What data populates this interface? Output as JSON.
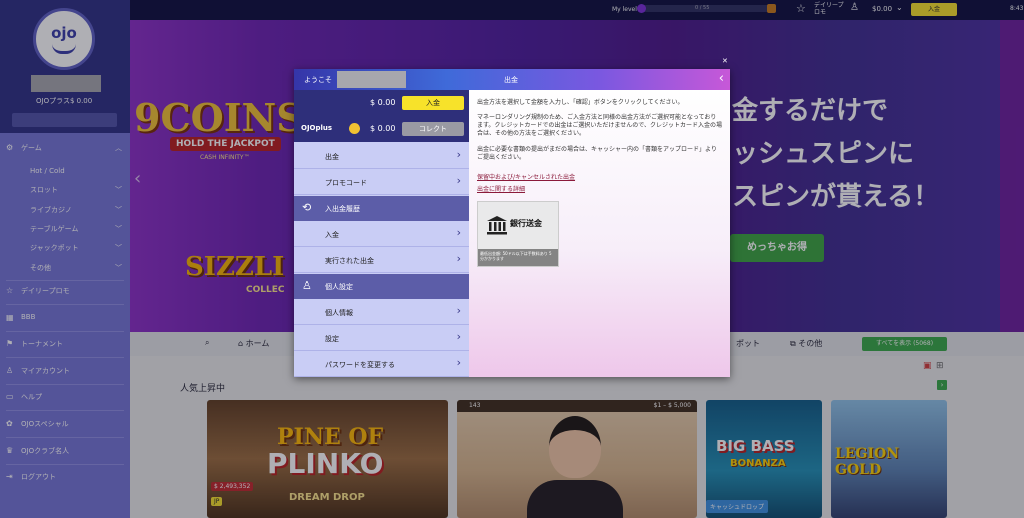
{
  "topbar": {
    "my_level": "My level",
    "level_progress": "0 / 55",
    "daily_promo": "デイリープロモ",
    "balance": "$0.00",
    "deposit": "入金",
    "time": "8:43"
  },
  "sidebar": {
    "logo": "ojo",
    "ojo_plus": "OJOプラス$ 0.00",
    "items": [
      {
        "label": "ゲーム"
      },
      {
        "label": "Hot / Cold"
      },
      {
        "label": "スロット"
      },
      {
        "label": "ライブカジノ"
      },
      {
        "label": "テーブルゲーム"
      },
      {
        "label": "ジャックポット"
      },
      {
        "label": "その他"
      },
      {
        "label": "デイリープロモ"
      },
      {
        "label": "BBB"
      },
      {
        "label": "トーナメント"
      },
      {
        "label": "マイアカウント"
      },
      {
        "label": "ヘルプ"
      },
      {
        "label": "OJOスペシャル"
      },
      {
        "label": "OJOクラブ名人"
      },
      {
        "label": "ログアウト"
      }
    ]
  },
  "banner": {
    "coin_title": "9COINS",
    "hold": "HOLD THE JACKPOT",
    "cash_infinity": "CASH INFINITY™",
    "sizzling": "SIZZLI",
    "collect": "COLLEC",
    "line1": "金するだけで",
    "line2": "ッシュスピンに",
    "line3": "スピンが貰える！",
    "cta": "めっちゃお得"
  },
  "tabs": {
    "home": "ホーム",
    "spot": "ポット",
    "other": "その他",
    "show_all": "すべてを表示 (5068)",
    "popular": "人気上昇中"
  },
  "tiles": {
    "plinko_top": "PINE OF",
    "plinko": "PLINKO",
    "dream_drop": "DREAM DROP",
    "plinko_jackpot": "$ 2,493,352",
    "live_count": "143",
    "live_range": "$1 – $ 5,000",
    "big_bass": "BIG BASS",
    "bonanza": "BONANZA",
    "cash_drop": "キャッシュドロップ",
    "legion": "LEGION GOLD"
  },
  "modal": {
    "welcome": "ようこそ",
    "title": "出金",
    "cash_balance": "$ 0.00",
    "deposit_btn": "入金",
    "ojoplus_label": "OJOplus",
    "ojoplus_balance": "$ 0.00",
    "collect_btn": "コレクト",
    "menu": [
      {
        "label": "出金",
        "type": "item"
      },
      {
        "label": "プロモコード",
        "type": "item"
      },
      {
        "label": "入出金履歴",
        "type": "section"
      },
      {
        "label": "入金",
        "type": "item"
      },
      {
        "label": "実行された出金",
        "type": "item"
      },
      {
        "label": "個人設定",
        "type": "section"
      },
      {
        "label": "個人情報",
        "type": "item"
      },
      {
        "label": "設定",
        "type": "item"
      },
      {
        "label": "パスワードを変更する",
        "type": "item"
      }
    ],
    "p1": "出金方法を選択して金額を入力し、「確認」ボタンをクリックしてください。",
    "p2": "マネーロンダリング規制のため、ご入金方法と同様の出金方法がご選択可能となっております。クレジットカードでの出金はご選択いただけませんので、クレジットカード入金の場合は、その他の方法をご選択ください。",
    "p3": "出金に必要な書類の提出がまだの場合は、キャッシャー内の「書類をアップロード」よりご提出ください。",
    "link1": "保留中および/キャンセルされた出金",
    "link2": "出金に関する詳細",
    "bank_label": "銀行送金",
    "bank_note": "最低出金額: 50ドル以下は手数料あり 5 分かかります"
  }
}
